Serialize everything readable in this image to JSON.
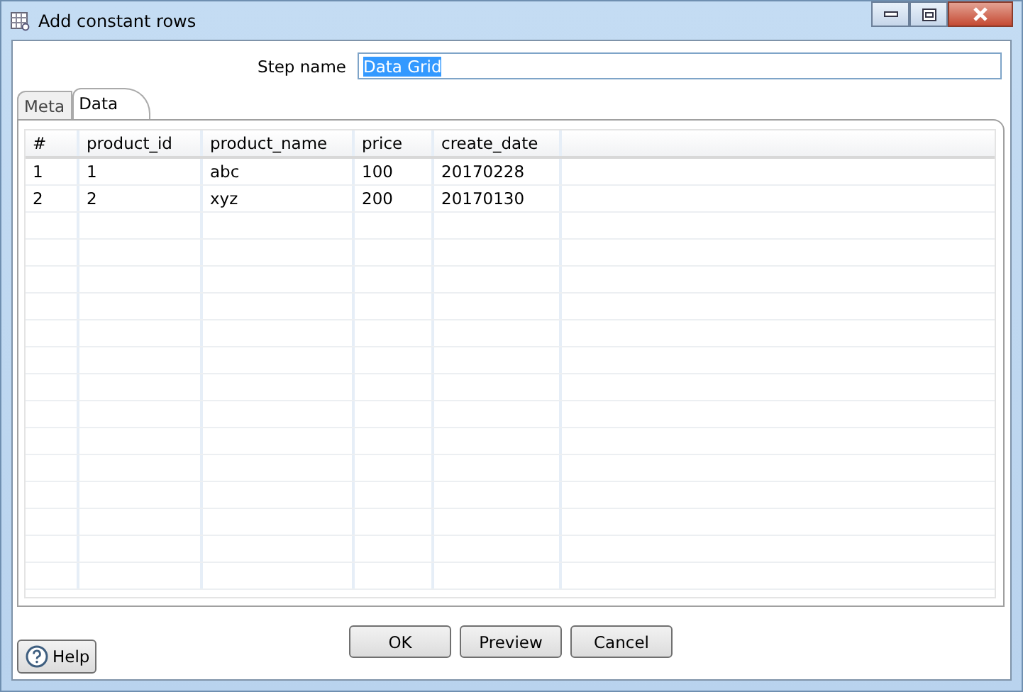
{
  "window": {
    "title": "Add constant rows"
  },
  "step_name": {
    "label": "Step name",
    "value": "Data Grid",
    "value_selected": true
  },
  "tabs": [
    {
      "label": "Meta",
      "selected": false
    },
    {
      "label": "Data",
      "selected": true
    }
  ],
  "table": {
    "columns": [
      "#",
      "product_id",
      "product_name",
      "price",
      "create_date"
    ],
    "rows": [
      [
        "1",
        "1",
        "abc",
        "100",
        "20170228"
      ],
      [
        "2",
        "2",
        "xyz",
        "200",
        "20170130"
      ]
    ]
  },
  "buttons": [
    "OK",
    "Preview",
    "Cancel"
  ],
  "help": {
    "label": "Help"
  }
}
